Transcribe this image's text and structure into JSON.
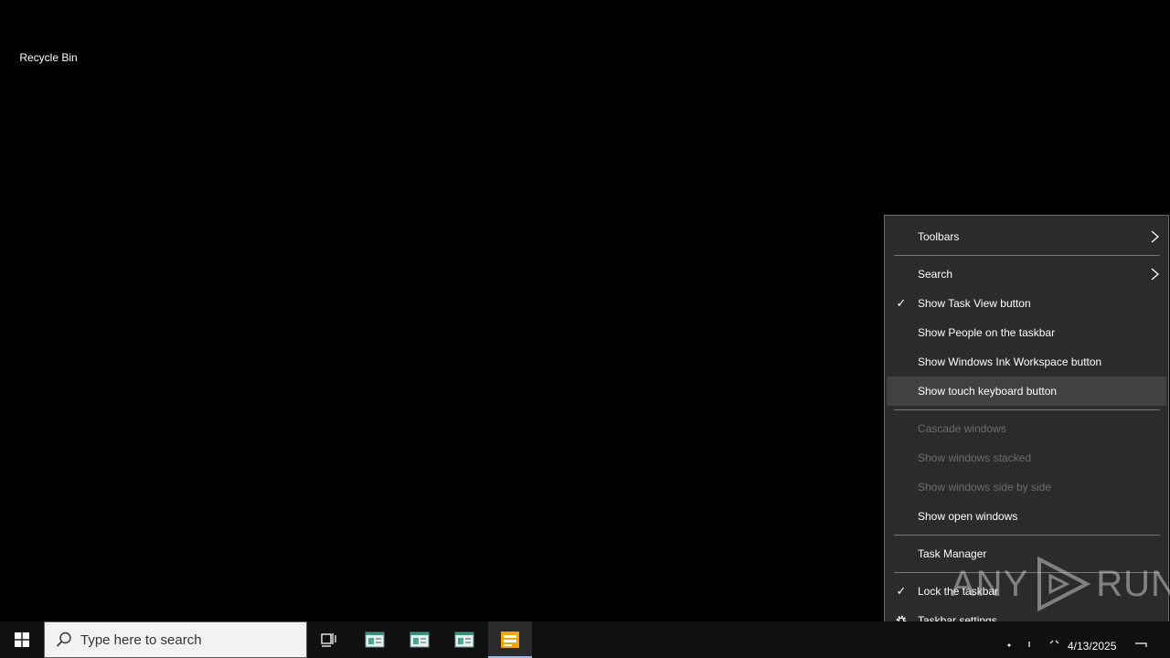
{
  "desktop": {
    "icons": [
      {
        "label": "Recycle Bin",
        "icon": "recycle-bin-icon"
      }
    ]
  },
  "context_menu": {
    "items": [
      {
        "label": "Toolbars",
        "checked": false,
        "enabled": true,
        "submenu": true
      },
      {
        "label": "Search",
        "checked": false,
        "enabled": true,
        "submenu": true
      },
      {
        "label": "Show Task View button",
        "checked": true,
        "enabled": true,
        "submenu": false
      },
      {
        "label": "Show People on the taskbar",
        "checked": false,
        "enabled": true,
        "submenu": false
      },
      {
        "label": "Show Windows Ink Workspace button",
        "checked": false,
        "enabled": true,
        "submenu": false
      },
      {
        "label": "Show touch keyboard button",
        "checked": false,
        "enabled": true,
        "submenu": false,
        "highlighted": true
      },
      {
        "label": "Cascade windows",
        "checked": false,
        "enabled": false,
        "submenu": false
      },
      {
        "label": "Show windows stacked",
        "checked": false,
        "enabled": false,
        "submenu": false
      },
      {
        "label": "Show windows side by side",
        "checked": false,
        "enabled": false,
        "submenu": false
      },
      {
        "label": "Show open windows",
        "checked": false,
        "enabled": true,
        "submenu": false
      },
      {
        "label": "Task Manager",
        "checked": false,
        "enabled": true,
        "submenu": false
      },
      {
        "label": "Lock the taskbar",
        "checked": true,
        "enabled": true,
        "submenu": false
      },
      {
        "label": "Taskbar settings",
        "checked": false,
        "enabled": true,
        "submenu": false,
        "icon": "gear-icon"
      }
    ],
    "check_glyph": "✓"
  },
  "watermark": {
    "left": "ANY",
    "right": "RUN"
  },
  "taskbar": {
    "search": {
      "placeholder": "Type here to search"
    },
    "apps": [
      {
        "name": "task-view-button",
        "icon": "task-view-icon"
      },
      {
        "name": "taskbar-app-1",
        "icon": "app-window-icon"
      },
      {
        "name": "taskbar-app-2",
        "icon": "app-window-icon"
      },
      {
        "name": "taskbar-app-3",
        "icon": "app-window-icon"
      },
      {
        "name": "taskbar-app-4",
        "icon": "app-window-icon",
        "active": true
      }
    ],
    "tray": {
      "date": "4/13/2025"
    }
  },
  "colors": {
    "menu_bg": "#2b2b2b",
    "menu_highlight": "#414141",
    "taskbar_bg": "#101010",
    "active_app_accent": "#f0a30a"
  }
}
